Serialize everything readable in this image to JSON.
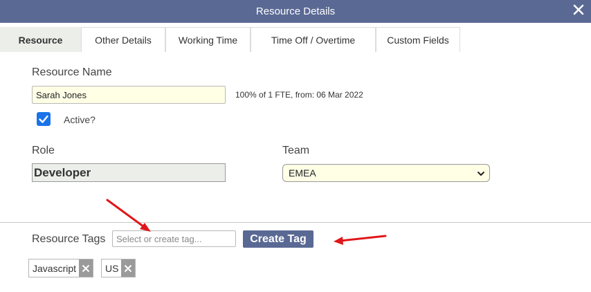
{
  "window": {
    "title": "Resource Details",
    "close_icon": "close-icon"
  },
  "tabs": [
    {
      "label": "Resource",
      "active": true
    },
    {
      "label": "Other Details",
      "active": false
    },
    {
      "label": "Working Time",
      "active": false
    },
    {
      "label": "Time Off / Overtime",
      "active": false
    },
    {
      "label": "Custom Fields",
      "active": false
    }
  ],
  "resource": {
    "name_label": "Resource Name",
    "name_value": "Sarah Jones",
    "fte_info": "100% of 1 FTE, from: 06 Mar 2022",
    "active_label": "Active?",
    "active_checked": true
  },
  "role": {
    "label": "Role",
    "value": "Developer"
  },
  "team": {
    "label": "Team",
    "selected": "EMEA"
  },
  "tags": {
    "label": "Resource Tags",
    "input_placeholder": "Select or create tag...",
    "create_button": "Create Tag",
    "items": [
      "Javascript",
      "US"
    ]
  },
  "colors": {
    "header": "#5a6994",
    "field_background": "#ffffe6",
    "checkbox": "#1a73e8",
    "annotation_arrow": "#e0171a"
  }
}
